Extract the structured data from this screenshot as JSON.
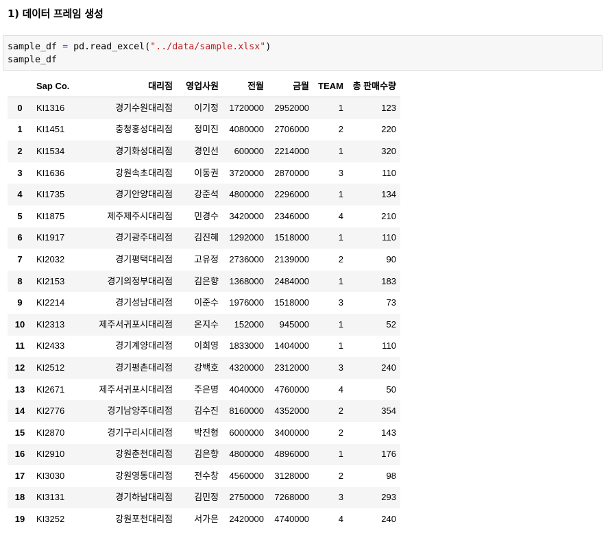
{
  "heading": "1) 데이터 프레임 생성",
  "code": {
    "line1_var": "sample_df",
    "line1_op": "=",
    "line1_call": "pd.read_excel(",
    "line1_str": "\"../data/sample.xlsx\"",
    "line1_close": ")",
    "line2": "sample_df"
  },
  "table": {
    "columns": [
      "",
      "Sap Co.",
      "대리점",
      "영업사원",
      "전월",
      "금월",
      "TEAM",
      "총 판매수량"
    ],
    "rows": [
      [
        "0",
        "KI1316",
        "경기수원대리점",
        "이기정",
        "1720000",
        "2952000",
        "1",
        "123"
      ],
      [
        "1",
        "KI1451",
        "충청홍성대리점",
        "정미진",
        "4080000",
        "2706000",
        "2",
        "220"
      ],
      [
        "2",
        "KI1534",
        "경기화성대리점",
        "경인선",
        "600000",
        "2214000",
        "1",
        "320"
      ],
      [
        "3",
        "KI1636",
        "강원속초대리점",
        "이동권",
        "3720000",
        "2870000",
        "3",
        "110"
      ],
      [
        "4",
        "KI1735",
        "경기안양대리점",
        "강준석",
        "4800000",
        "2296000",
        "1",
        "134"
      ],
      [
        "5",
        "KI1875",
        "제주제주시대리점",
        "민경수",
        "3420000",
        "2346000",
        "4",
        "210"
      ],
      [
        "6",
        "KI1917",
        "경기광주대리점",
        "김진혜",
        "1292000",
        "1518000",
        "1",
        "110"
      ],
      [
        "7",
        "KI2032",
        "경기평택대리점",
        "고유정",
        "2736000",
        "2139000",
        "2",
        "90"
      ],
      [
        "8",
        "KI2153",
        "경기의정부대리점",
        "김은향",
        "1368000",
        "2484000",
        "1",
        "183"
      ],
      [
        "9",
        "KI2214",
        "경기성남대리점",
        "이준수",
        "1976000",
        "1518000",
        "3",
        "73"
      ],
      [
        "10",
        "KI2313",
        "제주서귀포시대리점",
        "온지수",
        "152000",
        "945000",
        "1",
        "52"
      ],
      [
        "11",
        "KI2433",
        "경기계양대리점",
        "이희영",
        "1833000",
        "1404000",
        "1",
        "110"
      ],
      [
        "12",
        "KI2512",
        "경기평촌대리점",
        "강백호",
        "4320000",
        "2312000",
        "3",
        "240"
      ],
      [
        "13",
        "KI2671",
        "제주서귀포시대리점",
        "주은명",
        "4040000",
        "4760000",
        "4",
        "50"
      ],
      [
        "14",
        "KI2776",
        "경기남양주대리점",
        "김수진",
        "8160000",
        "4352000",
        "2",
        "354"
      ],
      [
        "15",
        "KI2870",
        "경기구리시대리점",
        "박진형",
        "6000000",
        "3400000",
        "2",
        "143"
      ],
      [
        "16",
        "KI2910",
        "강원춘천대리점",
        "김은향",
        "4800000",
        "4896000",
        "1",
        "176"
      ],
      [
        "17",
        "KI3030",
        "강원영동대리점",
        "전수창",
        "4560000",
        "3128000",
        "2",
        "98"
      ],
      [
        "18",
        "KI3131",
        "경기하남대리점",
        "김민정",
        "2750000",
        "7268000",
        "3",
        "293"
      ],
      [
        "19",
        "KI3252",
        "강원포천대리점",
        "서가은",
        "2420000",
        "4740000",
        "4",
        "240"
      ]
    ]
  }
}
